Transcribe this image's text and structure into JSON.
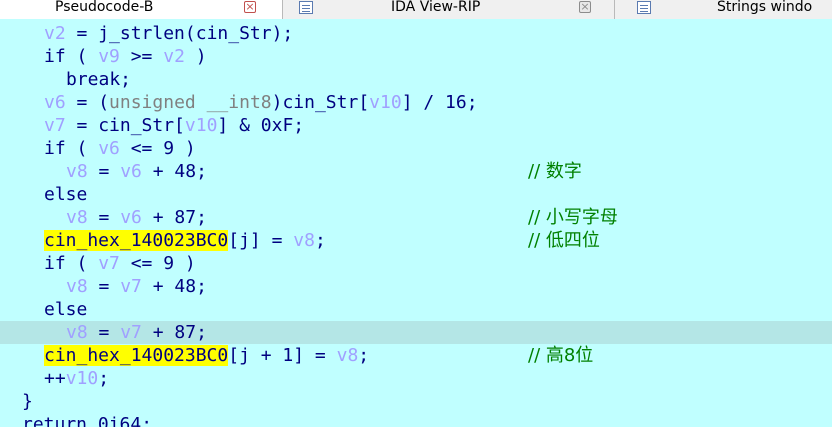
{
  "tabs": [
    {
      "label": "Pseudocode-B",
      "active": true
    },
    {
      "label": "IDA View-RIP",
      "active": false
    },
    {
      "label": "Strings windo",
      "active": false
    }
  ],
  "close_glyph": "×",
  "lines": [
    {
      "code": "v2 = j_strlen(cin_Str);"
    },
    {
      "code": "if ( v9 >= v2 )"
    },
    {
      "code": "break;"
    },
    {
      "code": "v6 = (unsigned __int8)cin_Str[v10] / 16;"
    },
    {
      "code": "v7 = cin_Str[v10] & 0xF;"
    },
    {
      "code": "if ( v6 <= 9 )"
    },
    {
      "code": "v8 = v6 + 48;",
      "comment": "// 数字"
    },
    {
      "code": "else"
    },
    {
      "code": "v8 = v6 + 87;",
      "comment": "// 小写字母"
    },
    {
      "code": "cin_hex_140023BC0[j] = v8;",
      "comment": "// 低四位"
    },
    {
      "code": "if ( v7 <= 9 )"
    },
    {
      "code": "v8 = v7 + 48;"
    },
    {
      "code": "else"
    },
    {
      "code": "v8 = v7 + 87;",
      "current": true
    },
    {
      "code": "cin_hex_140023BC0[j + 1] = v8;",
      "comment": "// 高8位"
    },
    {
      "code": "++v10;"
    },
    {
      "code": "}"
    },
    {
      "code": "return 0i64;"
    }
  ],
  "colors": {
    "background": "#c0ffff",
    "current_line": "#b4e6e6",
    "keyword": "#000080",
    "local_variable": "#a0a0ff",
    "comment": "#008000",
    "global_highlight": "#ffff00"
  }
}
